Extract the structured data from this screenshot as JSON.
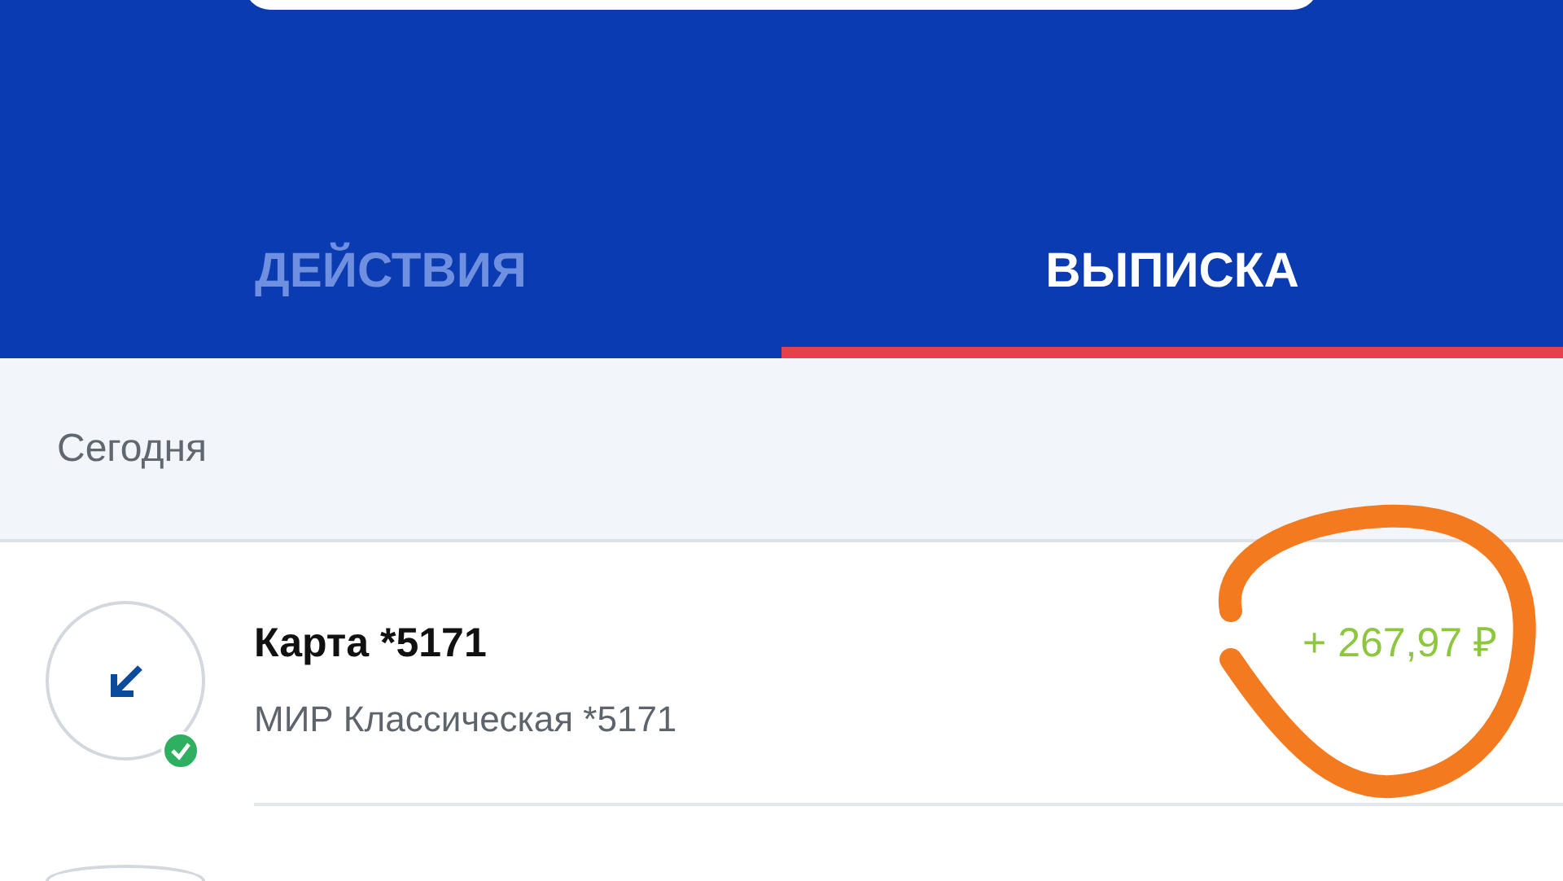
{
  "tabs": [
    {
      "label": "ДЕЙСТВИЯ",
      "selected": false
    },
    {
      "label": "ВЫПИСКА",
      "selected": true
    }
  ],
  "section": {
    "label": "Сегодня"
  },
  "transactions": [
    {
      "title": "Карта *5171",
      "subtitle": "МИР Классическая *5171",
      "amount": "+ 267,97 ₽",
      "incoming": true,
      "completed": true
    }
  ]
}
